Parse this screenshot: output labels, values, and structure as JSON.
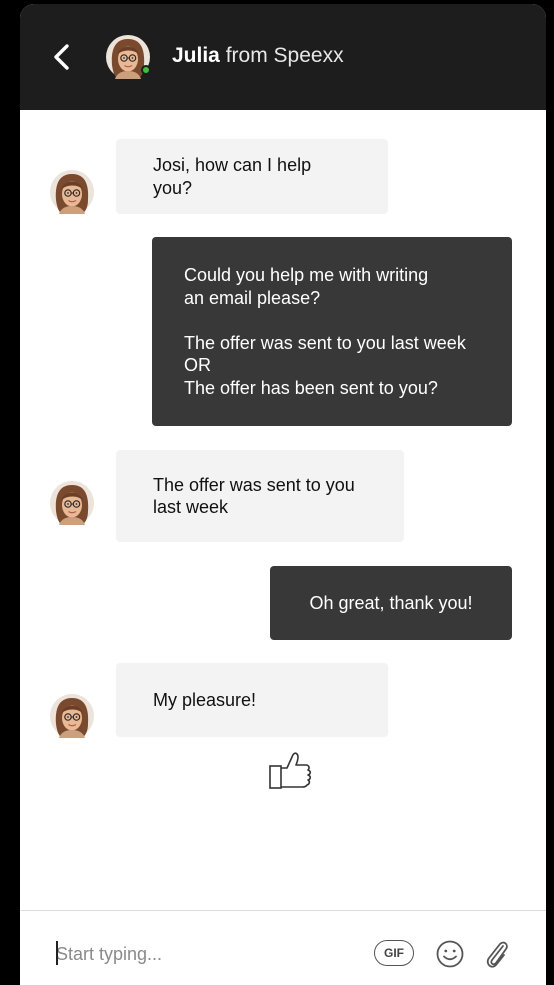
{
  "header": {
    "agent_name": "Julia",
    "from_text": "from Speexx"
  },
  "messages": [
    {
      "direction": "incoming",
      "text": "Josi, how can I help you?"
    },
    {
      "direction": "outgoing",
      "text": "Could you help me with writing\nan email please?\n\nThe offer was sent to you last week\nOR\nThe offer has been sent to you?"
    },
    {
      "direction": "incoming",
      "text": "The offer was sent to you\nlast week"
    },
    {
      "direction": "outgoing",
      "text": "Oh great, thank you!"
    },
    {
      "direction": "incoming",
      "text": "My pleasure!"
    }
  ],
  "reaction": "thumbs-up",
  "composer": {
    "placeholder": "Start typing...",
    "gif_label": "GIF"
  },
  "colors": {
    "header_bg": "#1d1d1d",
    "incoming_bubble": "#f3f3f3",
    "outgoing_bubble": "#383838",
    "online_status": "#3fbf3f"
  }
}
